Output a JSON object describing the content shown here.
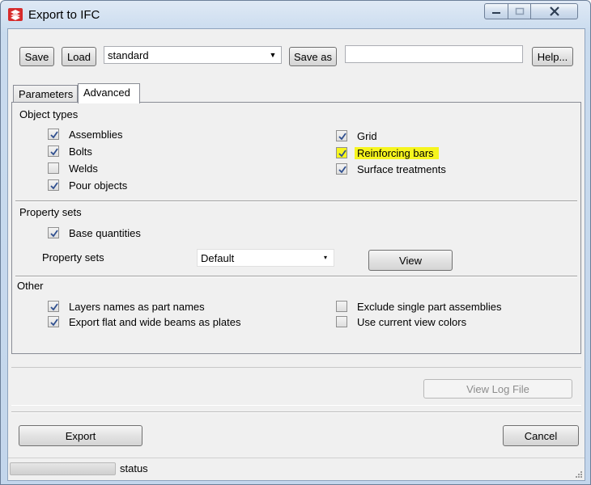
{
  "window": {
    "title": "Export to IFC"
  },
  "toolbar": {
    "save_label": "Save",
    "load_label": "Load",
    "preset_value": "standard",
    "save_as_label": "Save as",
    "save_as_value": "",
    "help_label": "Help..."
  },
  "tabs": [
    {
      "label": "Parameters",
      "active": false
    },
    {
      "label": "Advanced",
      "active": true
    }
  ],
  "object_types": {
    "label": "Object types",
    "left": [
      {
        "label": "Assemblies",
        "checked": true
      },
      {
        "label": "Bolts",
        "checked": true
      },
      {
        "label": "Welds",
        "checked": false
      },
      {
        "label": "Pour objects",
        "checked": true
      }
    ],
    "right": [
      {
        "label": "Grid",
        "checked": true
      },
      {
        "label": "Reinforcing bars",
        "checked": true
      },
      {
        "label": "Surface treatments",
        "checked": true
      }
    ]
  },
  "property_sets": {
    "label": "Property sets",
    "base_quantities": {
      "label": "Base quantities",
      "checked": true
    },
    "field_label": "Property sets",
    "selected": "Default",
    "view_label": "View"
  },
  "other": {
    "label": "Other",
    "left": [
      {
        "label": "Layers names as part names",
        "checked": true
      },
      {
        "label": "Export flat and wide beams as plates",
        "checked": true
      }
    ],
    "right": [
      {
        "label": "Exclude single part assemblies",
        "checked": false
      },
      {
        "label": "Use current view colors",
        "checked": false
      }
    ]
  },
  "log": {
    "view_log_label": "View Log File"
  },
  "footer": {
    "export_label": "Export",
    "cancel_label": "Cancel"
  },
  "status": {
    "text": "status"
  },
  "colors": {
    "highlight": "#f6f51e",
    "icon_red": "#d62b2b"
  }
}
